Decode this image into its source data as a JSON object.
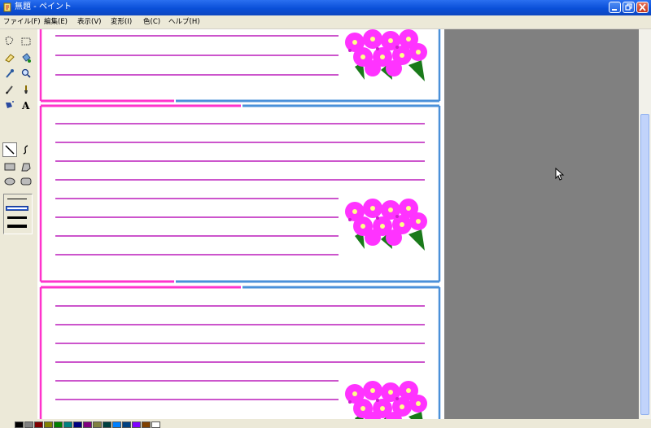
{
  "window": {
    "title": "無題 - ペイント"
  },
  "menu": {
    "items": [
      "ファイル(F)",
      "編集(E)",
      "表示(V)",
      "変形(I)",
      "色(C)",
      "ヘルプ(H)"
    ]
  },
  "toolbox": {
    "tools": [
      "free-select",
      "rect-select",
      "eraser",
      "fill",
      "color-picker",
      "magnifier",
      "pencil",
      "brush",
      "airbrush",
      "text",
      "line",
      "curve",
      "rectangle",
      "polygon",
      "ellipse",
      "rounded-rectangle"
    ],
    "selected_tool": "line"
  },
  "canvas": {
    "card_colors": {
      "pink": "#ff33cc",
      "blue": "#4a90d9",
      "ruled_line": "#cc55cc"
    },
    "flower_color": "#ff33ff"
  },
  "palette": {
    "colors": [
      "#000000",
      "#808080",
      "#800000",
      "#808000",
      "#008000",
      "#008080",
      "#000080",
      "#800080",
      "#808040",
      "#004040",
      "#0080ff",
      "#004080",
      "#8000ff",
      "#804000",
      "#ffffff"
    ]
  }
}
